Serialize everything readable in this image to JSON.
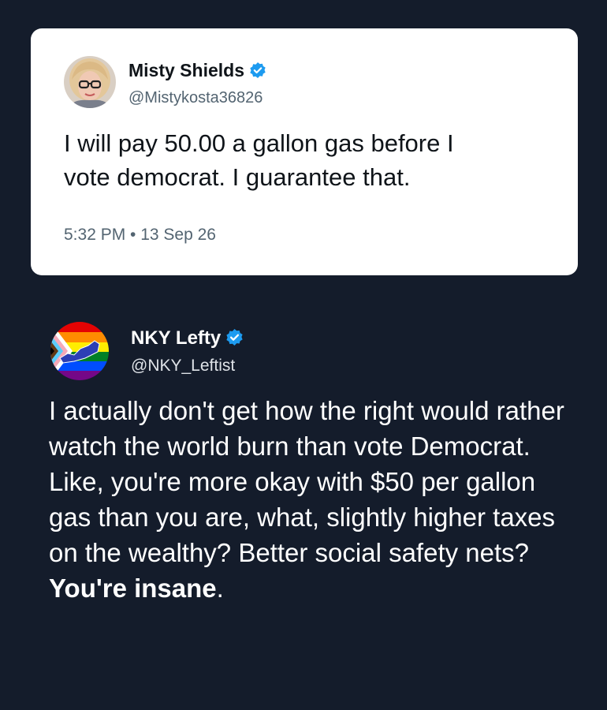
{
  "quoted_tweet": {
    "author_name": "Misty Shields",
    "handle": "@Mistykosta36826",
    "text": "I will pay 50.00 a gallon gas before I\nvote democrat.  I guarantee that.",
    "timestamp": "5:32 PM • 13 Sep 26"
  },
  "reply_tweet": {
    "author_name": "NKY Lefty",
    "handle": "@NKY_Leftist",
    "text": "I actually don't get how the right would rather watch the world burn than vote Democrat. Like, you're more okay with $50 per gallon gas than you are, what, slightly higher taxes on the wealthy? Better social safety nets? ",
    "text_bold": "You're insane",
    "text_end": "."
  },
  "colors": {
    "background": "#141c2b",
    "card": "#ffffff",
    "verified_badge": "#1d9bf0"
  },
  "icons": {
    "verified": "verified-badge-icon"
  }
}
